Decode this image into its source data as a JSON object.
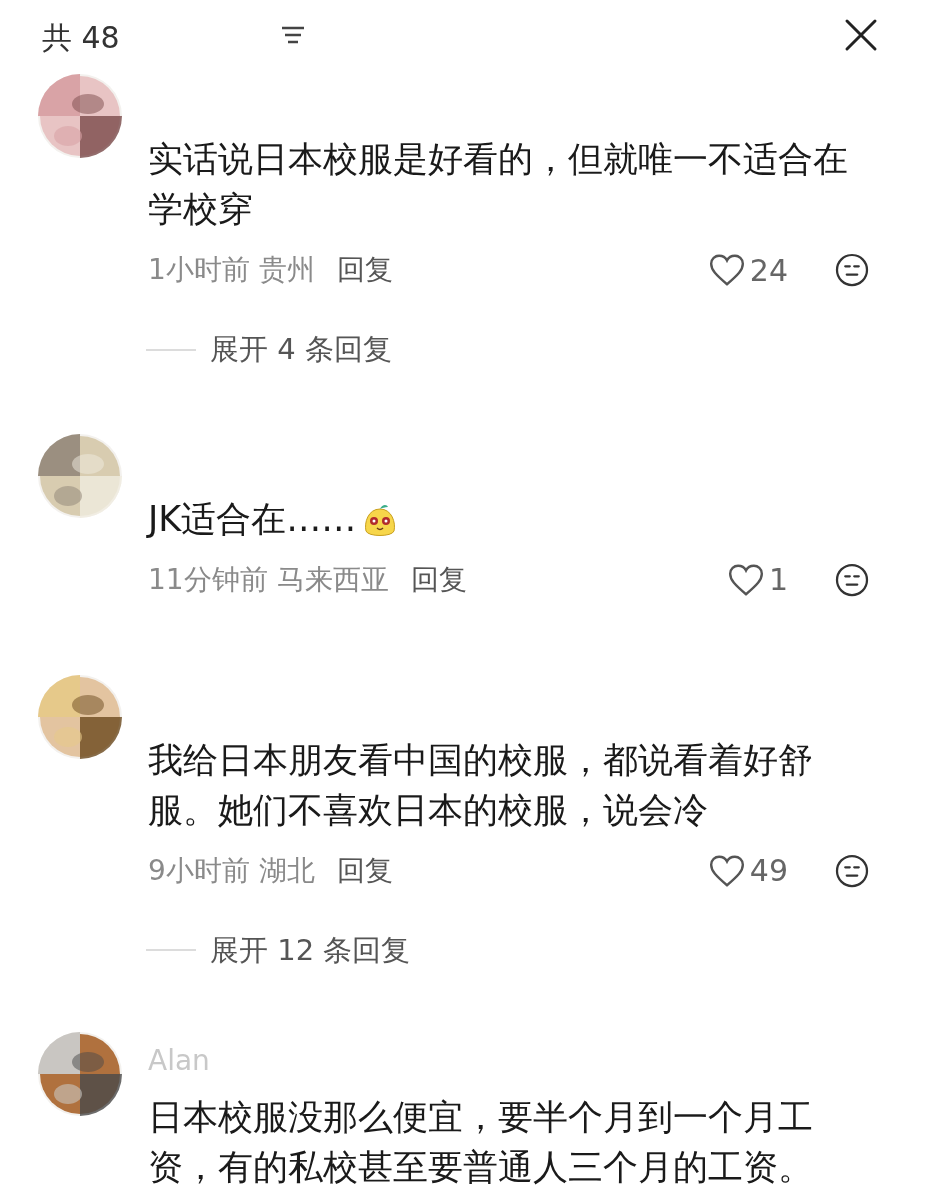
{
  "header": {
    "count_text": "共 48"
  },
  "comments": [
    {
      "text": "实话说日本校服是好看的，但就唯一不适合在学校穿",
      "emoji": false,
      "time": "1小时前",
      "location": "贵州",
      "reply": "回复",
      "likes": "24",
      "expand": "展开 4 条回复"
    },
    {
      "text": "JK适合在……",
      "emoji": true,
      "time": "11分钟前",
      "location": "马来西亚",
      "reply": "回复",
      "likes": "1"
    },
    {
      "text": "我给日本朋友看中国的校服，都说看着好舒服。她们不喜欢日本的校服，说会冷",
      "emoji": false,
      "time": "9小时前",
      "location": "湖北",
      "reply": "回复",
      "likes": "49",
      "expand": "展开 12 条回复"
    },
    {
      "username": "Alan",
      "text": "日本校服没那么便宜，要半个月到一个月工资，有的私校甚至要普通人三个月的工资。",
      "emoji": false
    }
  ]
}
